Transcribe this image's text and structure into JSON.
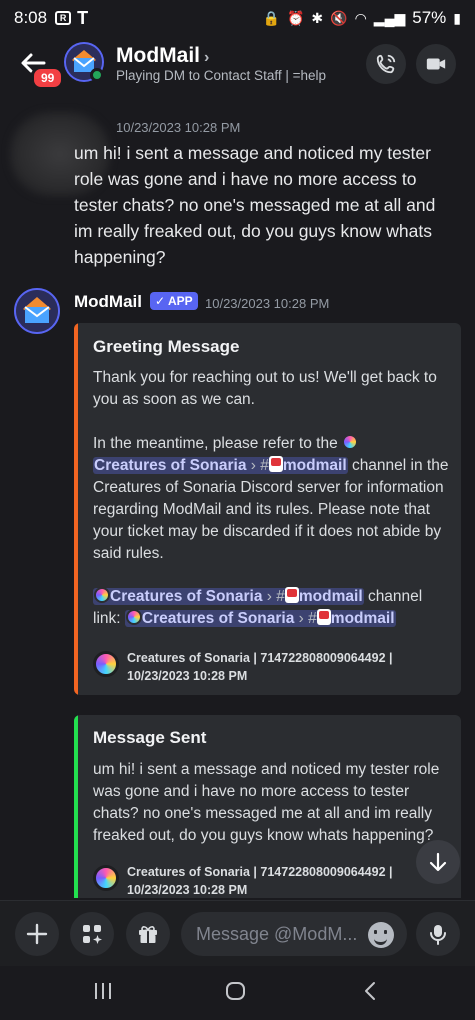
{
  "status_bar": {
    "time": "8:08",
    "battery": "57%"
  },
  "header": {
    "unread_badge": "99",
    "title": "ModMail",
    "subtitle": "Playing DM to Contact Staff | =help",
    "icons": [
      "back-arrow-icon",
      "phone-icon",
      "video-camera-icon"
    ]
  },
  "messages": [
    {
      "timestamp": "10/23/2023 10:28 PM",
      "text": "um hi! i sent a message and noticed my tester role was gone and i have no more access to tester chats? no one's messaged me at all and im really freaked out, do you guys know whats happening?"
    },
    {
      "author": "ModMail",
      "tag": "✓ APP",
      "timestamp": "10/23/2023 10:28 PM",
      "embeds": [
        {
          "accent_color": "#f26522",
          "title": "Greeting Message",
          "p1": "Thank you for reaching out to us! We'll get back to you as soon as we can.",
          "p2_prefix": "In the meantime, please refer to the",
          "server_mention": "Creatures of Sonaria",
          "channel_mention": "modmail",
          "p2_suffix": "channel",
          "p2_rest": "in the Creatures of Sonaria Discord server for information regarding ModMail and its rules. Please note that your ticket may be discarded if it does not abide by said rules.",
          "p3_mid": "channel",
          "p3_link": "link:",
          "footer": "Creatures of Sonaria | 714722808009064492 | 10/23/2023 10:28 PM"
        },
        {
          "accent_color": "#23e04f",
          "title": "Message Sent",
          "body": "um hi! i sent a message and noticed my tester role was gone and i have no more access to tester chats? no one's messaged me at all and im really freaked out, do you guys know whats happening?",
          "footer": "Creatures of Sonaria | 714722808009064492 | 10/23/2023 10:28 PM"
        }
      ]
    }
  ],
  "composer": {
    "placeholder": "Message @ModM..."
  },
  "colors": {
    "background": "#1a1a1e",
    "embed": "#2b2d31",
    "blurple": "#5865f2"
  }
}
